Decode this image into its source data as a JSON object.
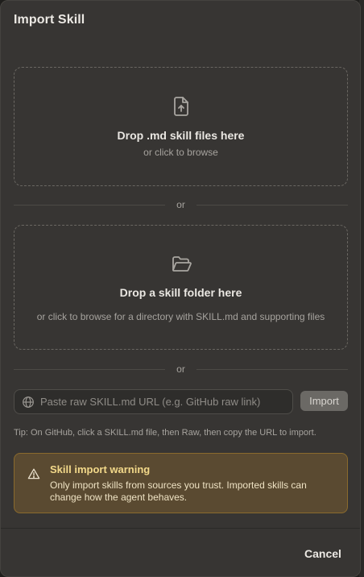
{
  "dialog": {
    "title": "Import Skill"
  },
  "file_drop": {
    "icon": "file-upload-icon",
    "title": "Drop .md skill files here",
    "subtitle": "or click to browse"
  },
  "divider_text": "or",
  "folder_drop": {
    "icon": "folder-open-icon",
    "title": "Drop a skill folder here",
    "subtitle": "or click to browse for a directory with SKILL.md and supporting files"
  },
  "url_import": {
    "icon": "globe-icon",
    "placeholder": "Paste raw SKILL.md URL (e.g. GitHub raw link)",
    "value": "",
    "button_label": "Import"
  },
  "tip": "Tip: On GitHub, click a SKILL.md file, then Raw, then copy the URL to import.",
  "warning": {
    "icon": "warning-triangle-icon",
    "title": "Skill import warning",
    "body": "Only import skills from sources you trust. Imported skills can change how the agent behaves.",
    "colors": {
      "background": "#5a4a31",
      "border": "#8a6a2d",
      "title": "#f3d98a"
    }
  },
  "footer": {
    "cancel_label": "Cancel"
  }
}
